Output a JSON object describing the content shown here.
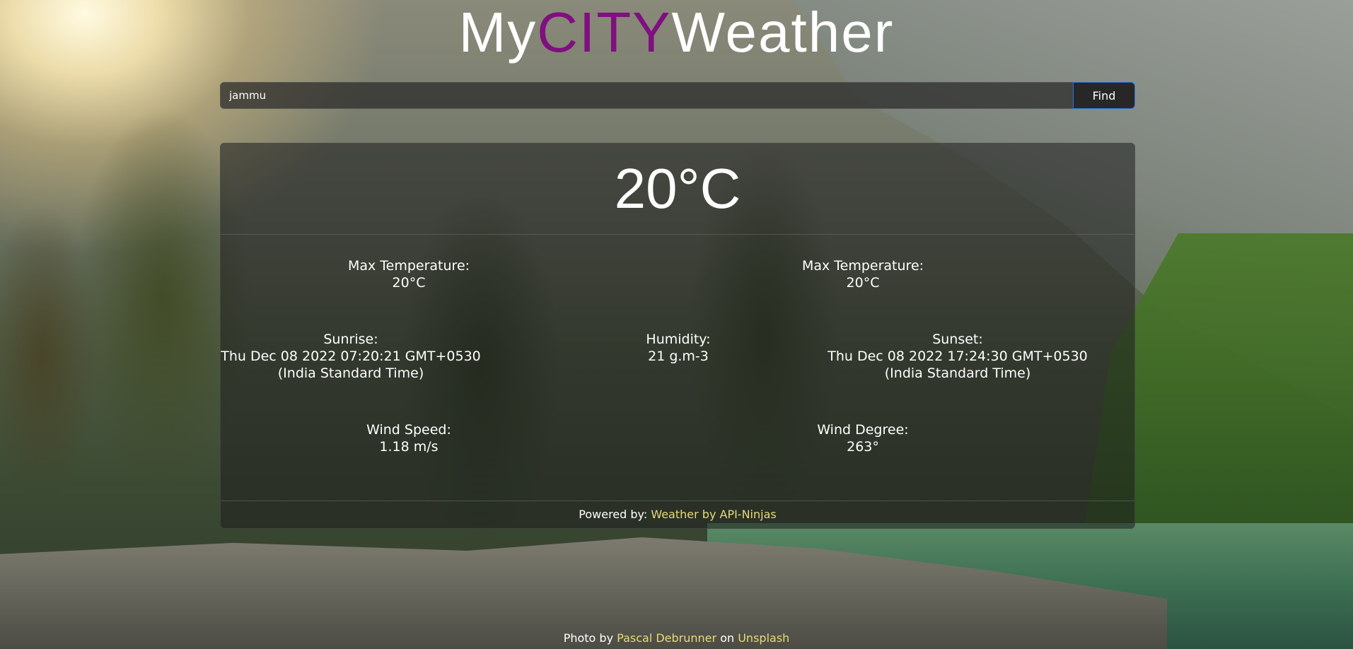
{
  "app": {
    "title_my": "My",
    "title_city": "CITY",
    "title_weather": "Weather"
  },
  "search": {
    "value": "jammu",
    "placeholder": "",
    "button_label": "Find"
  },
  "weather": {
    "temperature": "20°C",
    "max_temp_left": {
      "label": "Max Temperature:",
      "value": "20°C"
    },
    "max_temp_right": {
      "label": "Max Temperature:",
      "value": "20°C"
    },
    "sunrise": {
      "label": "Sunrise:",
      "value_line1": "Thu Dec 08 2022 07:20:21 GMT+0530",
      "value_line2": "(India Standard Time)"
    },
    "humidity": {
      "label": "Humidity:",
      "value": "21 g.m-3"
    },
    "sunset": {
      "label": "Sunset:",
      "value_line1": "Thu Dec 08 2022 17:24:30 GMT+0530",
      "value_line2": "(India Standard Time)"
    },
    "wind_speed": {
      "label": "Wind Speed:",
      "value": "1.18 m/s"
    },
    "wind_degree": {
      "label": "Wind Degree:",
      "value": "263°"
    }
  },
  "footer": {
    "powered_prefix": "Powered by:",
    "powered_link": "Weather by API-Ninjas"
  },
  "credit": {
    "prefix": "Photo by",
    "author": "Pascal Debrunner",
    "middle": "on",
    "site": "Unsplash"
  },
  "colors": {
    "accent_city": "#800f80",
    "link": "#e6d97a",
    "button_border": "#2d6fd6"
  }
}
